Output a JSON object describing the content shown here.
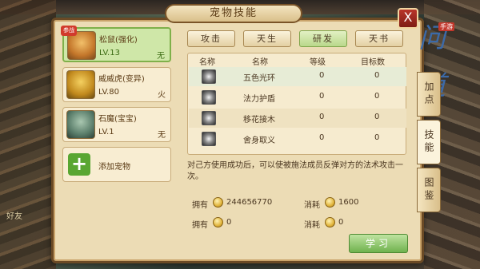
{
  "window": {
    "title": "宠物技能",
    "close_label": "X",
    "logo_text": "问道",
    "logo_badge": "手游",
    "scene_label": "好友"
  },
  "pets": [
    {
      "name": "松鼠(强化)",
      "level": "LV.13",
      "element": "无",
      "badge": "参战"
    },
    {
      "name": "威威虎(变异)",
      "level": "LV.80",
      "element": "火"
    },
    {
      "name": "石魔(宝宝)",
      "level": "LV.1",
      "element": "无"
    },
    {
      "name": "添加宠物"
    }
  ],
  "tabs": [
    "攻击",
    "天生",
    "研发",
    "天书"
  ],
  "active_tab": "研发",
  "table": {
    "headers": [
      "名称",
      "名称",
      "等级",
      "目标数"
    ],
    "rows": [
      {
        "name": "五色光环",
        "level": "0",
        "targets": "0"
      },
      {
        "name": "法力护盾",
        "level": "0",
        "targets": "0"
      },
      {
        "name": "移花接木",
        "level": "0",
        "targets": "0"
      },
      {
        "name": "舍身取义",
        "level": "0",
        "targets": "0"
      }
    ]
  },
  "description": "对己方使用成功后，可以使被施法成员反弹对方的法术攻击一次。",
  "stats": {
    "own_label": "拥有",
    "cost_label": "消耗",
    "own_coin": "244656770",
    "cost_coin": "1600",
    "own_item": "0",
    "cost_item": "0"
  },
  "learn_label": "学习",
  "side_tabs": [
    "加点",
    "技能",
    "图鉴"
  ],
  "colors": {
    "accent": "#7fb04a",
    "panel": "#ecdcb5",
    "border": "#6b4a25"
  }
}
